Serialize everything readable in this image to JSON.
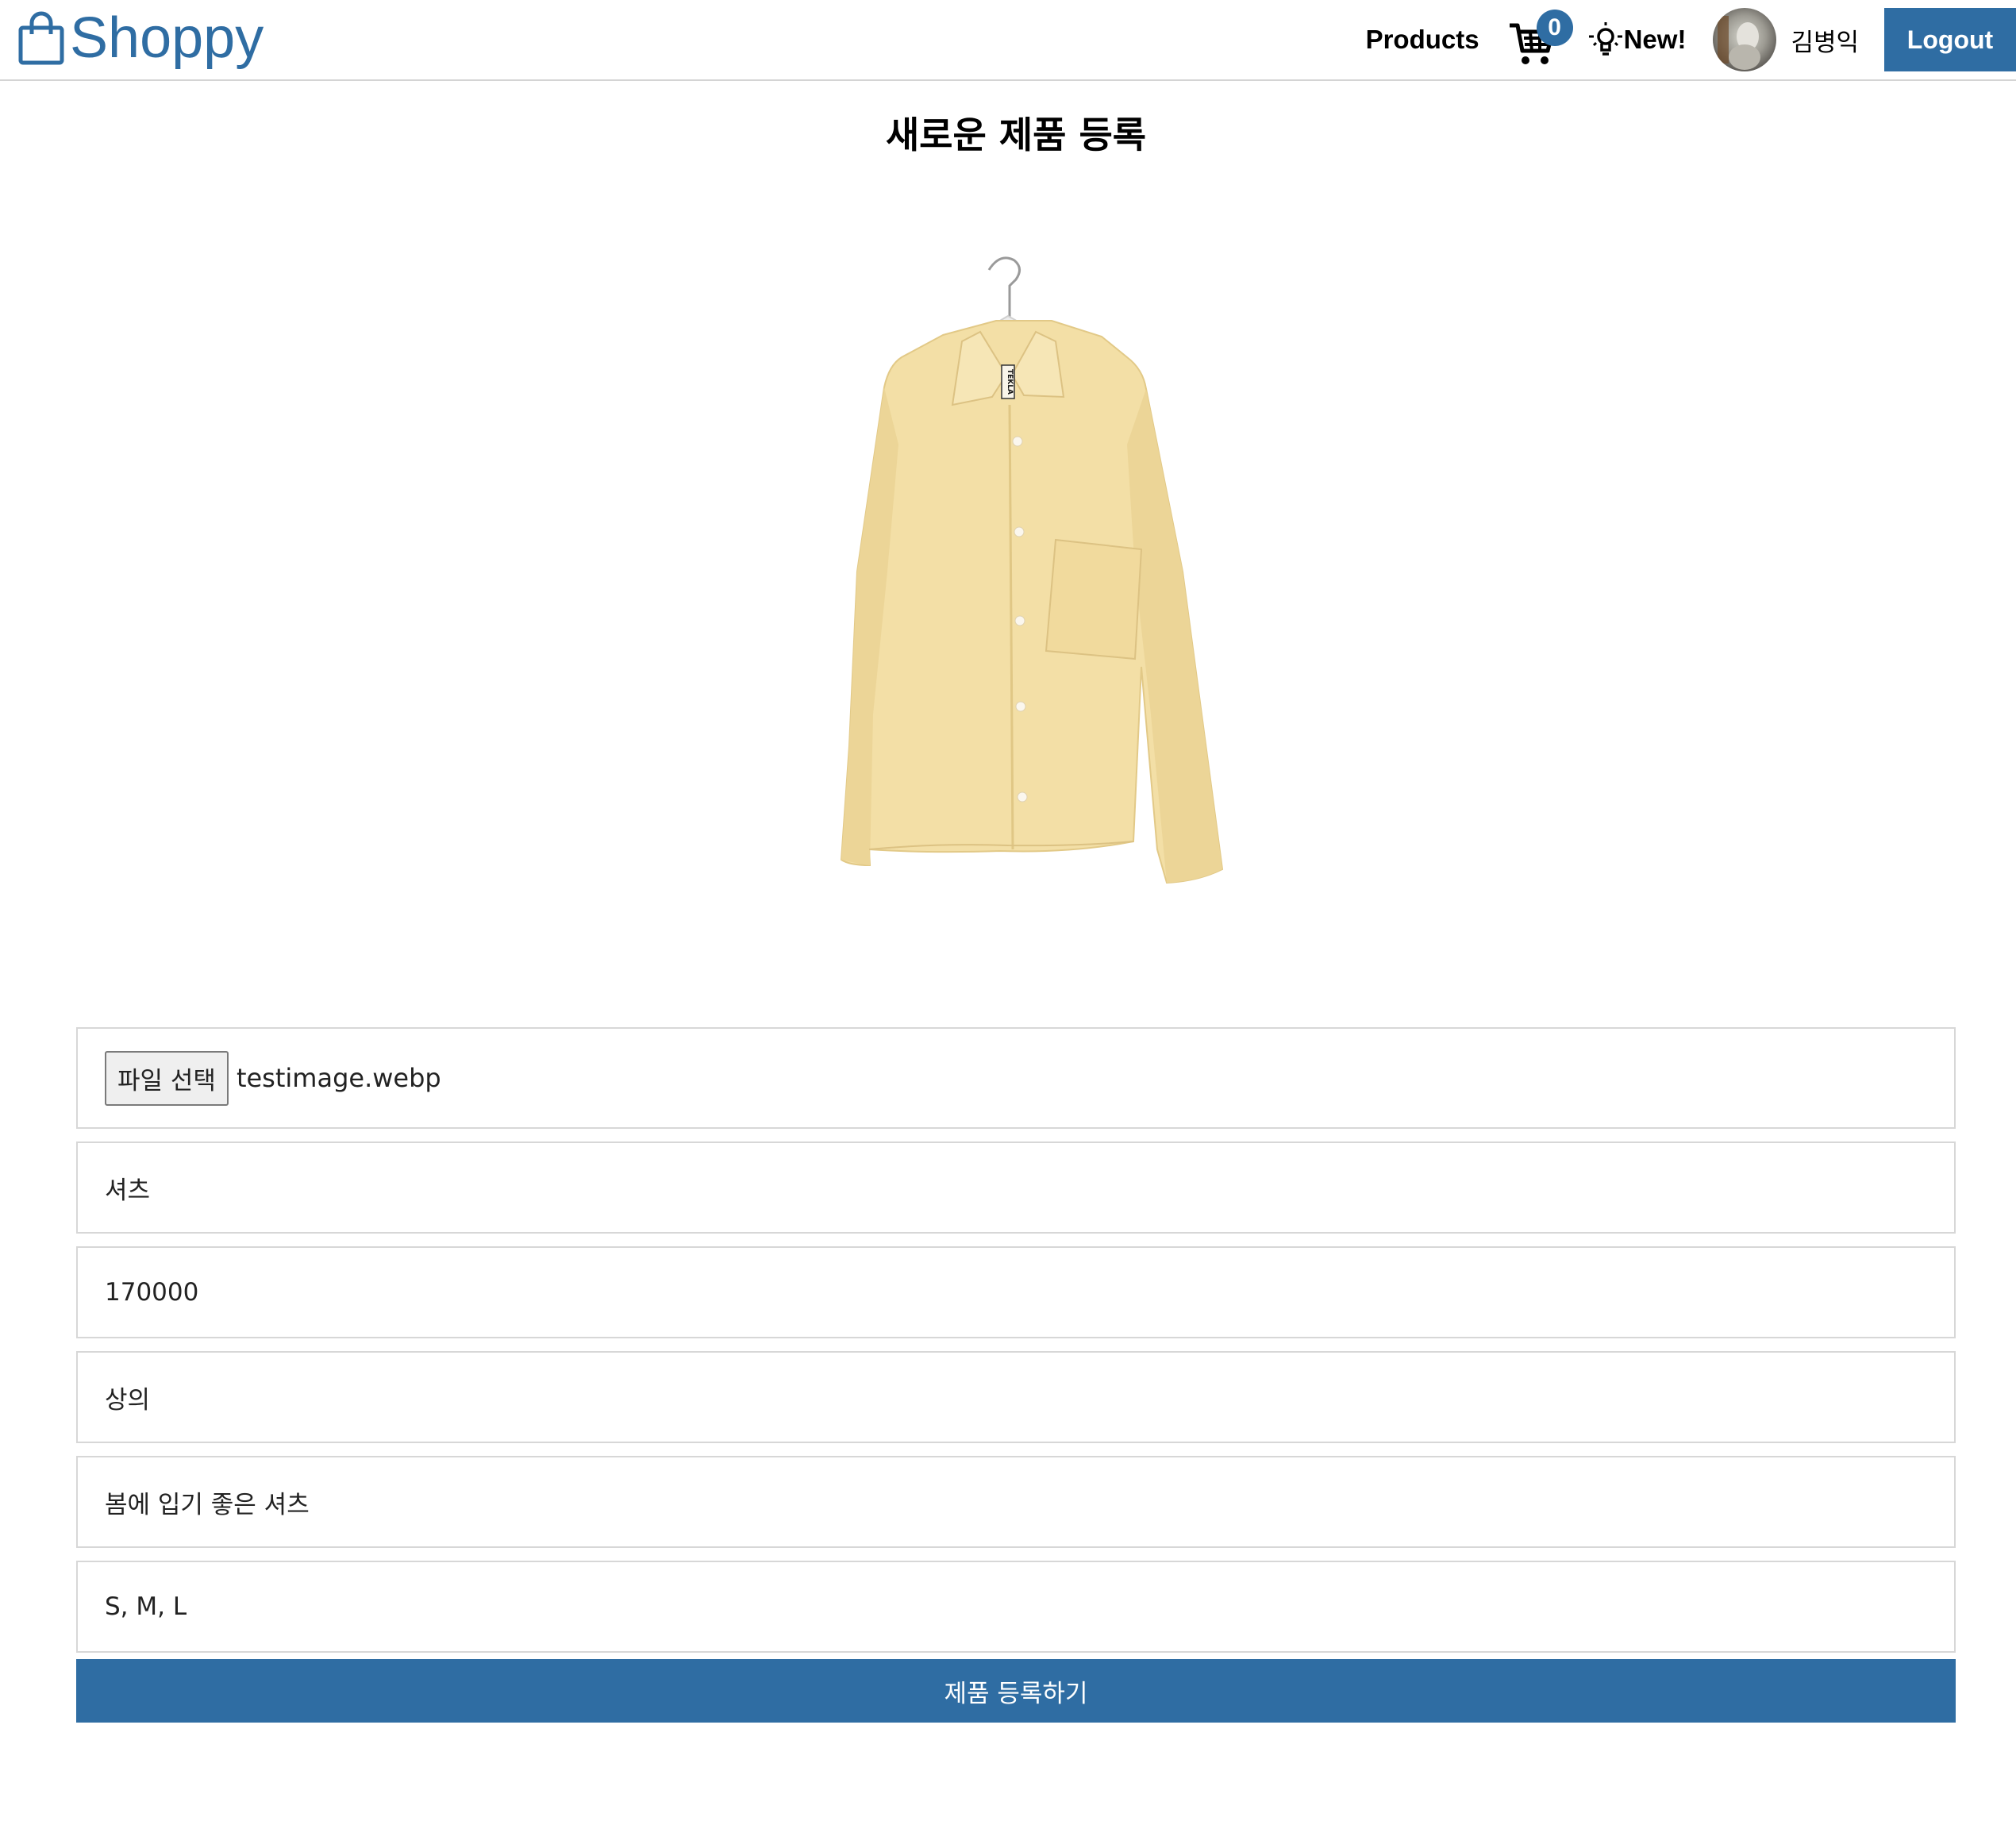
{
  "header": {
    "brand": "Shoppy",
    "nav_products": "Products",
    "cart_count": "0",
    "new_label": "New!",
    "username": "김병익",
    "logout_label": "Logout"
  },
  "page": {
    "title": "새로운 제품 등록"
  },
  "form": {
    "file_button_label": "파일 선택",
    "file_name": "testimage.webp",
    "name_value": "셔츠",
    "price_value": "170000",
    "category_value": "상의",
    "description_value": "봄에 입기 좋은 셔츠",
    "options_value": "S, M, L",
    "submit_label": "제품 등록하기"
  },
  "colors": {
    "brand": "#2f6da3",
    "shirt": "#f3dfa6",
    "border": "#d7d7d7"
  },
  "icons": [
    "shopping-bag-icon",
    "cart-icon",
    "lightbulb-icon"
  ]
}
